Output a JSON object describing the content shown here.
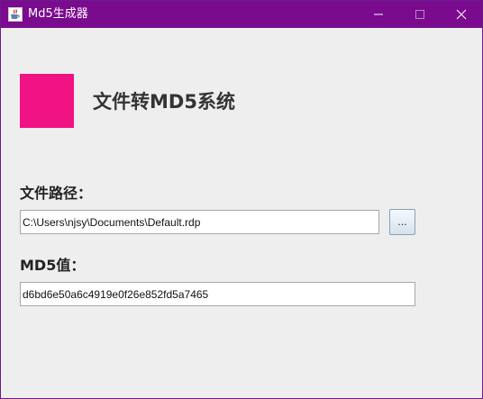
{
  "window": {
    "title": "Md5生成器"
  },
  "header": {
    "heading": "文件转MD5系统"
  },
  "file_path": {
    "label": "文件路径：",
    "value": "C:\\Users\\njsy\\Documents\\Default.rdp",
    "browse_label": "..."
  },
  "md5": {
    "label": "MD5值：",
    "value": "d6bd6e50a6c4919e0f26e852fd5a7465"
  },
  "colors": {
    "titlebar": "#7a0a8e",
    "logo": "#f11284",
    "background": "#eeeeee"
  },
  "icons": {
    "app": "coffee-cup-icon",
    "minimize": "minimize-icon",
    "maximize": "maximize-icon",
    "close": "close-icon"
  }
}
